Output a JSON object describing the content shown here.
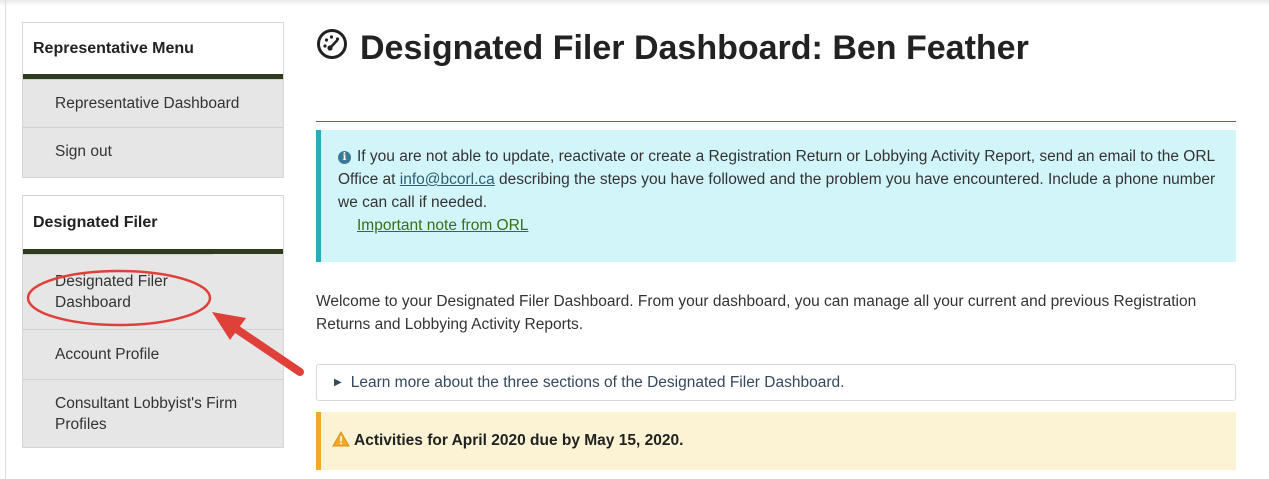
{
  "sidebar": {
    "rep_menu": {
      "heading": "Representative Menu",
      "items": [
        {
          "label": "Representative Dashboard"
        },
        {
          "label": "Sign out"
        }
      ]
    },
    "designated_filer": {
      "heading": "Designated Filer",
      "items": [
        {
          "label": "Designated Filer Dashboard"
        },
        {
          "label": "Account Profile"
        },
        {
          "label": "Consultant Lobbyist's Firm Profiles"
        }
      ]
    }
  },
  "main": {
    "title": "Designated Filer Dashboard: Ben Feather",
    "info": {
      "text_before": "If you are not able to update, reactivate or create a Registration Return or Lobbying Activity Report, send an email to the ORL Office at ",
      "email": "info@bcorl.ca",
      "text_after": " describing the steps you have followed and the problem you have encountered. Include a phone number we can call if needed.",
      "note_link": "Important note from ORL"
    },
    "welcome": "Welcome to your Designated Filer Dashboard. From your dashboard, you can manage all your current and previous Registration Returns and Lobbying Activity Reports.",
    "learn_more": "Learn more about the three sections of the Designated Filer Dashboard.",
    "alert": "Activities for April 2020 due by May 15, 2020."
  },
  "icons": {
    "title_icon": "dashboard-gauge-icon",
    "info_icon": "info-circle-icon",
    "alert_icon": "warning-triangle-icon",
    "expand_icon": "triangle-right-icon"
  },
  "colors": {
    "panel_border": "#2f3b1d",
    "info_bg": "#d2f5fa",
    "info_accent": "#2aa9bf",
    "alert_bg": "#fbf3d4",
    "alert_accent": "#f0a92a",
    "annotation": "#e0403a"
  }
}
